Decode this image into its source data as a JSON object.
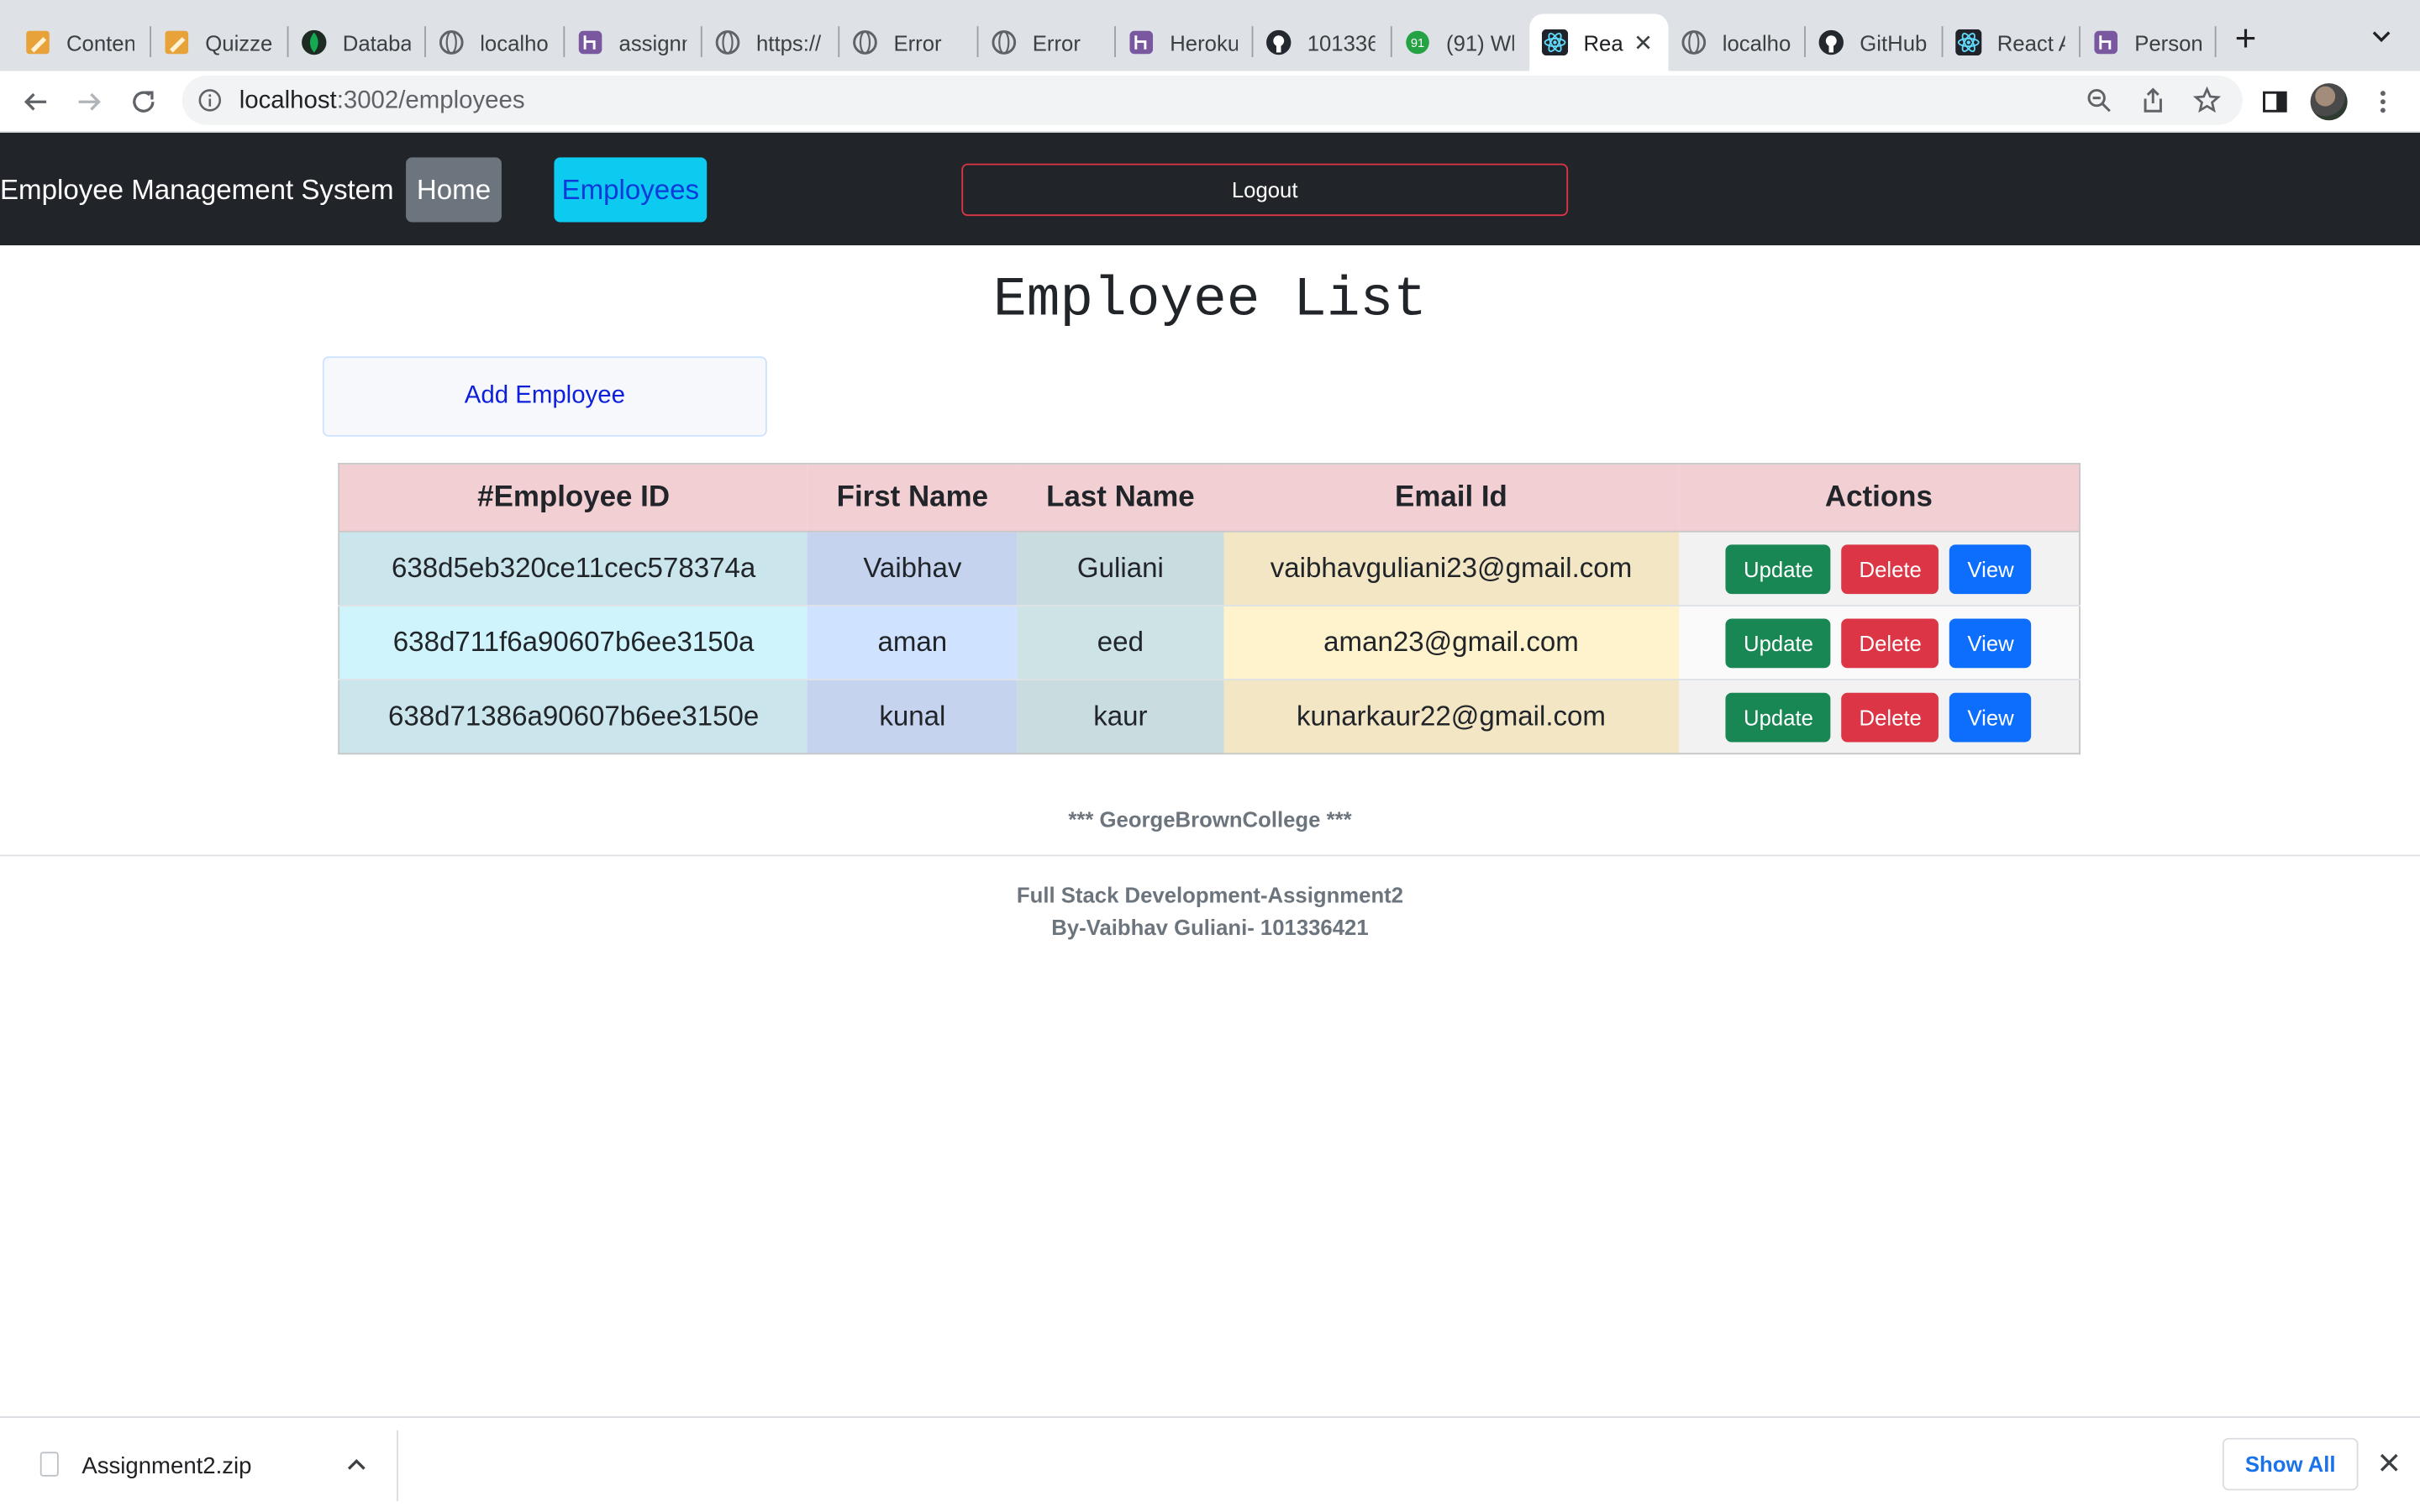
{
  "browser": {
    "tabs": [
      {
        "title": "Conten",
        "icon": "notepad-icon"
      },
      {
        "title": "Quizze",
        "icon": "notepad-icon"
      },
      {
        "title": "Databa",
        "icon": "mongodb-leaf-icon"
      },
      {
        "title": "localho",
        "icon": "globe-icon"
      },
      {
        "title": "assignn",
        "icon": "heroku-icon"
      },
      {
        "title": "https://",
        "icon": "globe-icon"
      },
      {
        "title": "Error",
        "icon": "globe-icon"
      },
      {
        "title": "Error",
        "icon": "globe-icon"
      },
      {
        "title": "Heroku",
        "icon": "heroku-icon"
      },
      {
        "title": "101336",
        "icon": "github-icon"
      },
      {
        "title": "(91) Wh",
        "icon": "whatsapp-icon"
      },
      {
        "title": "Rea",
        "icon": "react-icon",
        "active": true
      },
      {
        "title": "localho",
        "icon": "globe-icon"
      },
      {
        "title": "GitHub",
        "icon": "github-icon"
      },
      {
        "title": "React A",
        "icon": "react-icon"
      },
      {
        "title": "Person",
        "icon": "heroku-icon"
      }
    ],
    "url_host": "localhost",
    "url_rest": ":3002/employees"
  },
  "navbar": {
    "brand": "Employee Management System",
    "home": "Home",
    "employees": "Employees",
    "logout": "Logout"
  },
  "page": {
    "heading": "Employee List",
    "add_button": "Add Employee"
  },
  "table": {
    "headers": [
      "#Employee ID",
      "First Name",
      "Last Name",
      "Email Id",
      "Actions"
    ],
    "rows": [
      {
        "id": "638d5eb320ce11cec578374a",
        "first": "Vaibhav",
        "last": "Guliani",
        "email": "vaibhavguliani23@gmail.com"
      },
      {
        "id": "638d711f6a90607b6ee3150a",
        "first": "aman",
        "last": "eed",
        "email": "aman23@gmail.com"
      },
      {
        "id": "638d71386a90607b6ee3150e",
        "first": "kunal",
        "last": "kaur",
        "email": "kunarkaur22@gmail.com"
      }
    ],
    "actions": {
      "update": "Update",
      "delete": "Delete",
      "view": "View"
    }
  },
  "footer": {
    "college": "*** GeorgeBrownCollege ***",
    "line1": "Full Stack Development-Assignment2",
    "line2": "By-Vaibhav Guliani- 101336421"
  },
  "downloads": {
    "file": "Assignment2.zip",
    "show_all": "Show All"
  },
  "colors": {
    "navbar_bg": "#212529",
    "header_row": "#f2cfd3",
    "update": "#198754",
    "delete": "#dc3545",
    "view": "#0d6efd"
  }
}
